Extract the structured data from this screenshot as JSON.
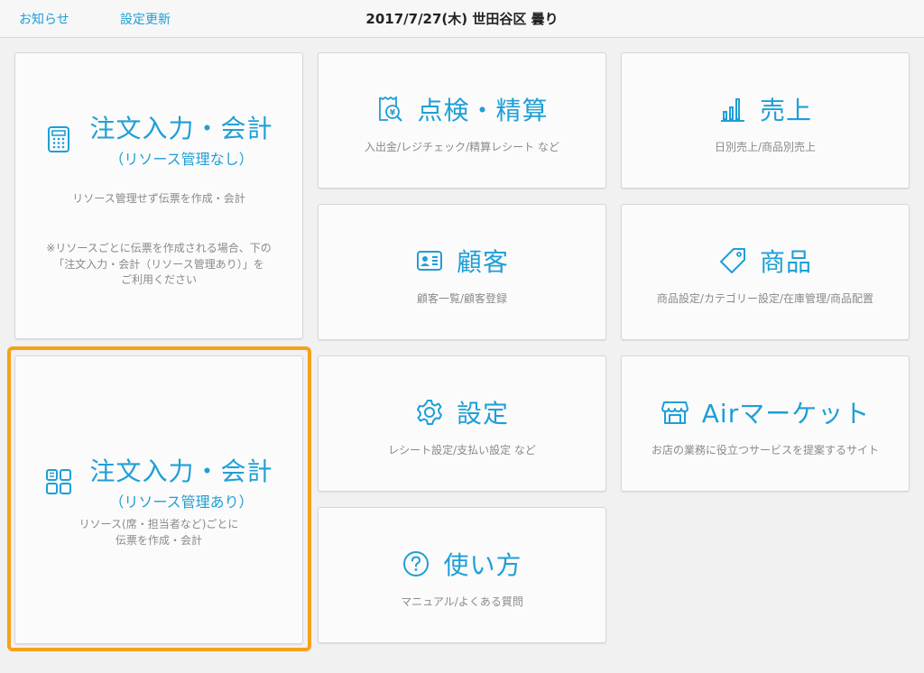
{
  "header": {
    "notice_link": "お知らせ",
    "settings_update_link": "設定更新",
    "title": "2017/7/27(木) 世田谷区 曇り"
  },
  "tiles": {
    "order_no_resource": {
      "title": "注文入力・会計",
      "subtitle": "（リソース管理なし）",
      "desc1": "リソース管理せず伝票を作成・会計",
      "note1": "※リソースごとに伝票を作成される場合、下の",
      "note2": "「注文入力・会計（リソース管理あり）」を",
      "note3": "ご利用ください",
      "icon": "calculator-icon"
    },
    "order_with_resource": {
      "title": "注文入力・会計",
      "subtitle": "（リソース管理あり）",
      "desc1": "リソース(席・担当者など)ごとに",
      "desc2": "伝票を作成・会計",
      "icon": "grid-icon"
    },
    "inspection": {
      "title": "点検・精算",
      "desc": "入出金/レジチェック/精算レシート など",
      "icon": "receipt-search-icon"
    },
    "sales": {
      "title": "売上",
      "desc": "日別売上/商品別売上",
      "icon": "bar-chart-icon"
    },
    "customers": {
      "title": "顧客",
      "desc": "顧客一覧/顧客登録",
      "icon": "customer-card-icon"
    },
    "products": {
      "title": "商品",
      "desc": "商品設定/カテゴリー設定/在庫管理/商品配置",
      "icon": "tag-icon"
    },
    "settings": {
      "title": "設定",
      "desc": "レシート設定/支払い設定 など",
      "icon": "gear-icon"
    },
    "air_market": {
      "title": "Airマーケット",
      "desc": "お店の業務に役立つサービスを提案するサイト",
      "icon": "store-icon"
    },
    "howto": {
      "title": "使い方",
      "desc": "マニュアル/よくある質問",
      "icon": "question-icon"
    }
  },
  "colors": {
    "accent": "#1e9fd6",
    "highlight": "#f7a11a",
    "description_text": "#8a8a8a"
  }
}
